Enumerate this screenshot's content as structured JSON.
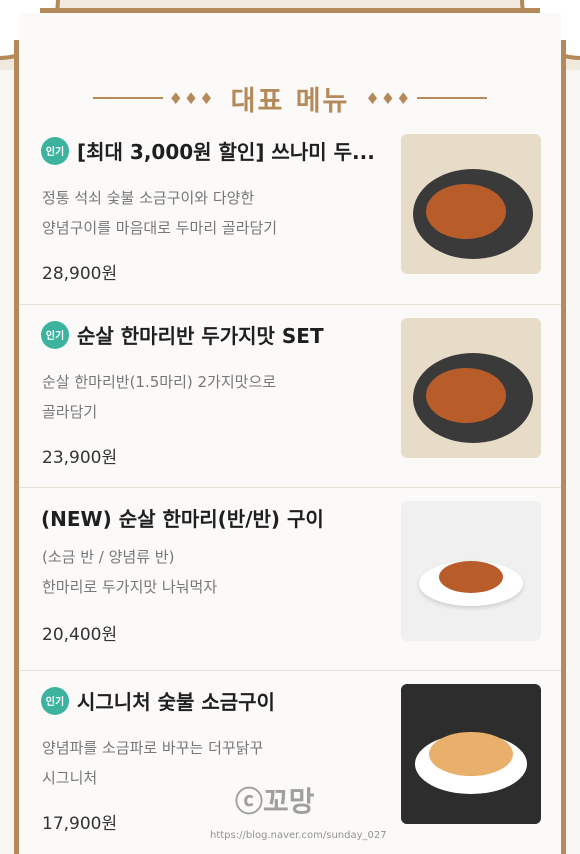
{
  "header": {
    "title": "대표 메뉴",
    "ornament": "♦♦♦"
  },
  "menu": [
    {
      "badge": "인기",
      "name": "[최대 3,000원 할인] 쓰나미 두...",
      "desc1": "정통 석쇠 숯불 소금구이와 다양한",
      "desc2": "양념구이를 마음대로 두마리 골라담기",
      "price": "28,900원"
    },
    {
      "badge": "인기",
      "name": "순살 한마리반 두가지맛 SET",
      "desc1": "순살 한마리반(1.5마리) 2가지맛으로",
      "desc2": "골라담기",
      "price": "23,900원"
    },
    {
      "badge": "",
      "name": "(NEW) 순살 한마리(반/반) 구이",
      "desc1": "(소금 반 / 양념류 반)",
      "desc2": "한마리로 두가지맛  나눠먹자",
      "price": "20,400원"
    },
    {
      "badge": "인기",
      "name": "시그니처 숯불 소금구이",
      "desc1": "양념파를 소금파로 바꾸는 더꾸닭꾸",
      "desc2": "시그니처",
      "price": "17,900원"
    }
  ],
  "watermark": {
    "text": "ⓒ꼬망",
    "url": "https://blog.naver.com/sunday_027"
  },
  "colors": {
    "accent": "#b48a5a",
    "badge": "#3bb39f"
  }
}
